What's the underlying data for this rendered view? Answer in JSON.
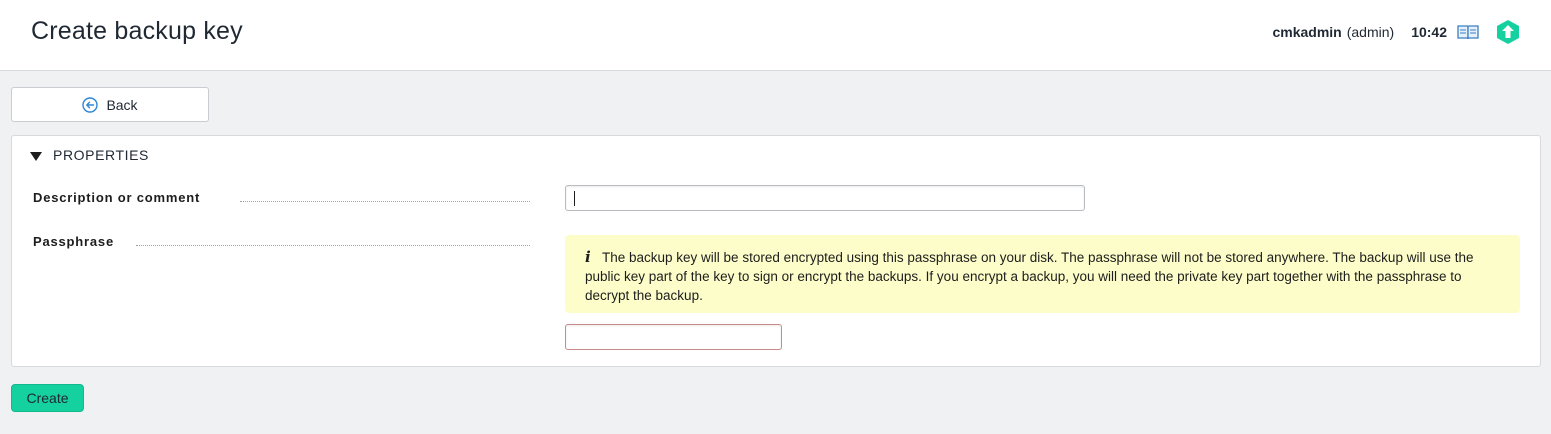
{
  "header": {
    "title": "Create backup key",
    "user_name": "cmkadmin",
    "user_role": "(admin)",
    "time": "10:42",
    "help_icon": "book-icon",
    "logo_icon": "checkmk-logo-icon",
    "accent_color": "#15d1a0"
  },
  "toolbar": {
    "back_label": "Back",
    "back_icon": "back-arrow-circle-icon"
  },
  "form": {
    "section_title": "PROPERTIES",
    "fields": [
      {
        "label": "Description or comment",
        "value": "",
        "placeholder": ""
      },
      {
        "label": "Passphrase",
        "value": "",
        "placeholder": ""
      }
    ],
    "info_text": "The backup key will be stored encrypted using this passphrase on your disk. The passphrase will not be stored anywhere. The backup will use the public key part of the key to sign or encrypt the backups. If you encrypt a backup, you will need the private key part together with the passphrase to decrypt the backup.",
    "info_icon": "info-icon"
  },
  "actions": {
    "create_label": "Create"
  }
}
